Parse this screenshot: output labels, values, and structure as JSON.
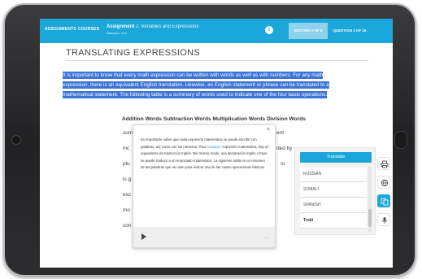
{
  "topbar": {
    "nav_assignments": "ASSIGNMENTS",
    "nav_courses": "COURSES",
    "assignment_label": "Assignment",
    "assignment_title": "2. Variables and Expressions",
    "attempt": "Attempt 1 of 3",
    "section_button": "SECTION 3 OF 8",
    "question_button": "QUESTION 3 OF 15",
    "accent_color": "#1ba7d9"
  },
  "page": {
    "title": "TRANSLATING EXPRESSIONS",
    "paragraph_lines": [
      "It is important to know that every math expression can be written with words as well as with numbers. For any math",
      "expression, there is an equivalent English translation. Likewise, an English statement or phrase can be translated to a",
      "mathematical statement. The following table is a summary of words used to indicate one of the four basic operations."
    ],
    "highlight_color": "#3b74d6"
  },
  "table": {
    "header_addition": "Addition Words",
    "header_subtraction": "Subtraction Words",
    "header_multiplication": "Multiplication Words",
    "header_division": "Division Words",
    "col1": [
      "sum",
      "inc",
      "plu",
      "is g",
      "exc",
      "mo",
      "con"
    ],
    "col_right": [
      "ent",
      "ded by",
      "or"
    ]
  },
  "popup": {
    "close": "×",
    "text_before_link": "Es importante saber que cada expresión matemática se puede escribir con palabras, así como con los números. Para ",
    "link": "cualquier",
    "text_after_link": " expresión matemática, hay un equivalente de traducción Inglés. Del mismo modo, una declaración inglés o frase se puede traducir a un enunciado matemático. La siguiente tabla es un resumen de las palabras que se usan para indicar una de las cuatro operaciones básicas.",
    "play_icon": "play-icon",
    "more": "...."
  },
  "translate_panel": {
    "button": "Translate",
    "options": [
      "RUSSIAN",
      "SOMALI",
      "SPANISH",
      "Trobi"
    ]
  },
  "toolbar": {
    "icons": [
      "printer-icon",
      "globe-icon",
      "translate-icon",
      "microphone-icon"
    ]
  }
}
